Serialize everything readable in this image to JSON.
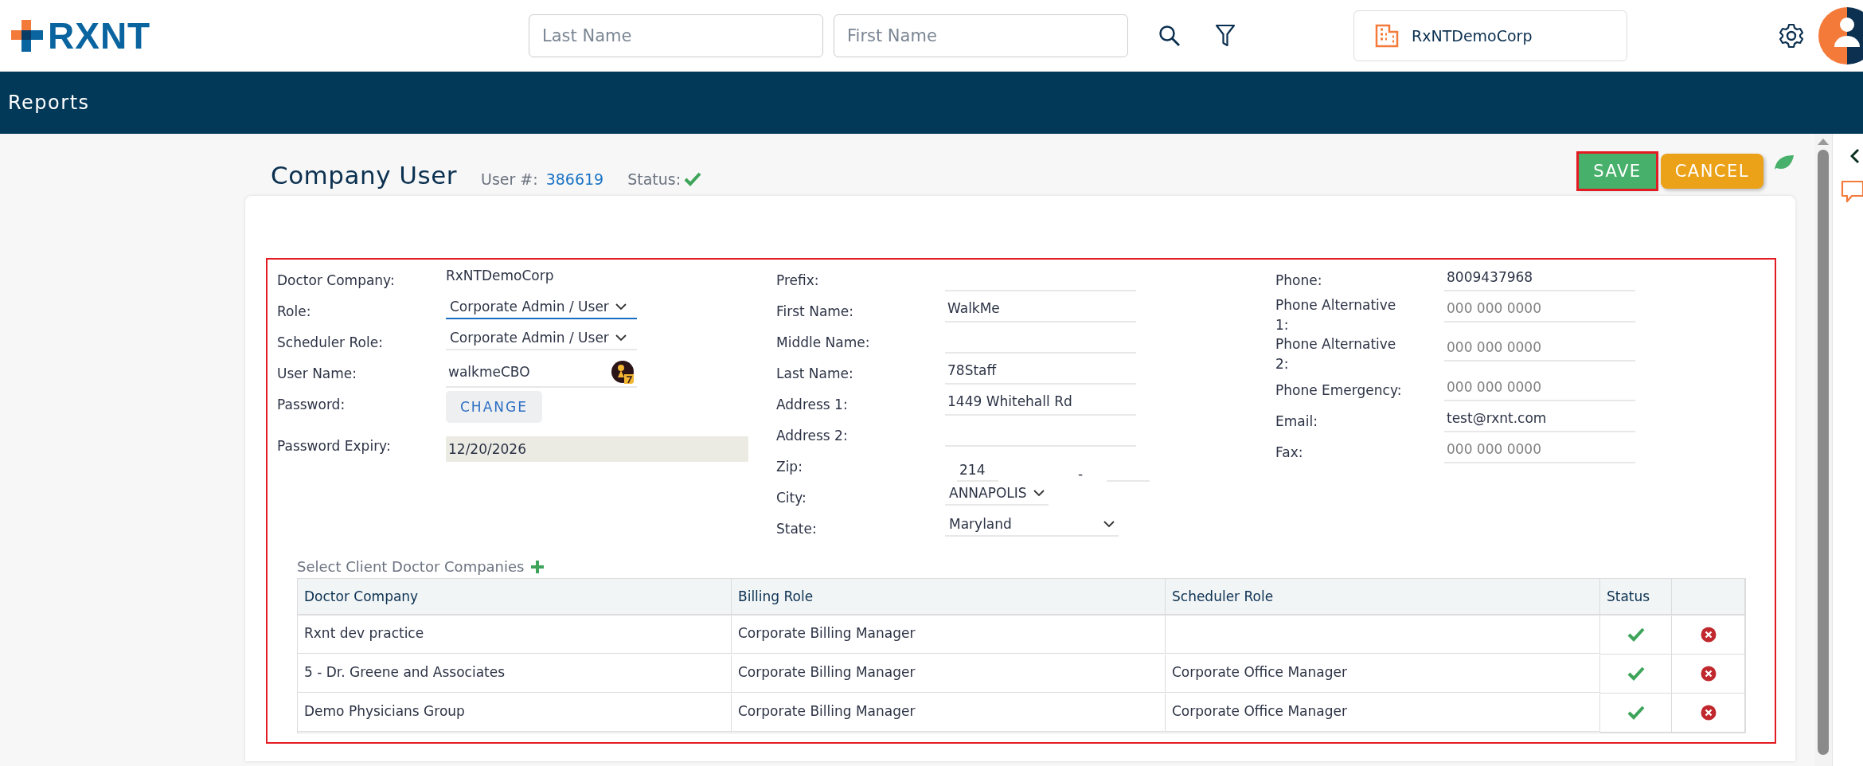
{
  "header": {
    "logo": "RXNT",
    "search_fields": [
      {
        "placeholder": "Last Name"
      },
      {
        "placeholder": "First Name"
      }
    ],
    "company": "RxNTDemoCorp"
  },
  "nav": {
    "title": "Reports"
  },
  "page": {
    "title": "Company User",
    "user_label": "User #:",
    "user_number": "386619",
    "status_label": "Status:",
    "status_active": true,
    "buttons": [
      {
        "label": "SAVE",
        "kind": "save",
        "highlighted": true
      },
      {
        "label": "CANCEL",
        "kind": "cancel",
        "highlighted": false
      }
    ]
  },
  "form_columns": [
    {
      "fields": [
        {
          "label": "Doctor Company:",
          "kind": "static",
          "value": "RxNTDemoCorp"
        },
        {
          "label": "Role:",
          "kind": "select",
          "value": "Corporate Admin / User",
          "focused": true
        },
        {
          "label": "Scheduler Role:",
          "kind": "select",
          "value": "Corporate Admin / User",
          "focused": false
        },
        {
          "label": "User Name:",
          "kind": "username",
          "value": "walkmeCBO"
        },
        {
          "label": "Password:",
          "kind": "button",
          "value": "CHANGE"
        },
        {
          "label": "Password Expiry:",
          "kind": "readonly",
          "value": "12/20/2026"
        }
      ]
    },
    {
      "fields": [
        {
          "label": "Prefix:",
          "kind": "text"
        },
        {
          "label": "First Name:",
          "kind": "text",
          "value": "WalkMe"
        },
        {
          "label": "Middle Name:",
          "kind": "text"
        },
        {
          "label": "Last Name:",
          "kind": "text",
          "value": "78Staff"
        },
        {
          "label": "Address 1:",
          "kind": "text",
          "value": "1449 Whitehall Rd"
        },
        {
          "label": "Address 2:",
          "kind": "text"
        },
        {
          "label": "Zip:",
          "kind": "zip",
          "value": "214",
          "separator": "-"
        },
        {
          "label": "City:",
          "kind": "select",
          "value": "ANNAPOLIS",
          "focused": false
        },
        {
          "label": "State:",
          "kind": "select",
          "value": "Maryland",
          "focused": false
        }
      ]
    },
    {
      "fields": [
        {
          "label": "Phone:",
          "kind": "text",
          "value": "8009437968"
        },
        {
          "label": "Phone Alternative 1:",
          "kind": "text",
          "placeholder": "000 000 0000"
        },
        {
          "label": "Phone Alternative 2:",
          "kind": "text",
          "placeholder": "000 000 0000"
        },
        {
          "label": "Phone Emergency:",
          "kind": "text",
          "placeholder": "000 000 0000"
        },
        {
          "label": "Email:",
          "kind": "text",
          "value": "test@rxnt.com"
        },
        {
          "label": "Fax:",
          "kind": "text",
          "placeholder": "000 000 0000"
        }
      ]
    }
  ],
  "client_companies": {
    "title": "Select Client Doctor Companies",
    "columns": [
      "Doctor Company",
      "Billing Role",
      "Scheduler Role",
      "Status"
    ],
    "rows": [
      {
        "doctor_company": "Rxnt dev practice",
        "billing_role": "Corporate Billing Manager",
        "active": true
      },
      {
        "doctor_company": "5 - Dr. Greene and Associates",
        "billing_role": "Corporate Billing Manager",
        "scheduler_role": "Corporate Office Manager",
        "active": true
      },
      {
        "doctor_company": "Demo Physicians Group",
        "billing_role": "Corporate Billing Manager",
        "scheduler_role": "Corporate Office Manager",
        "active": true
      }
    ]
  }
}
